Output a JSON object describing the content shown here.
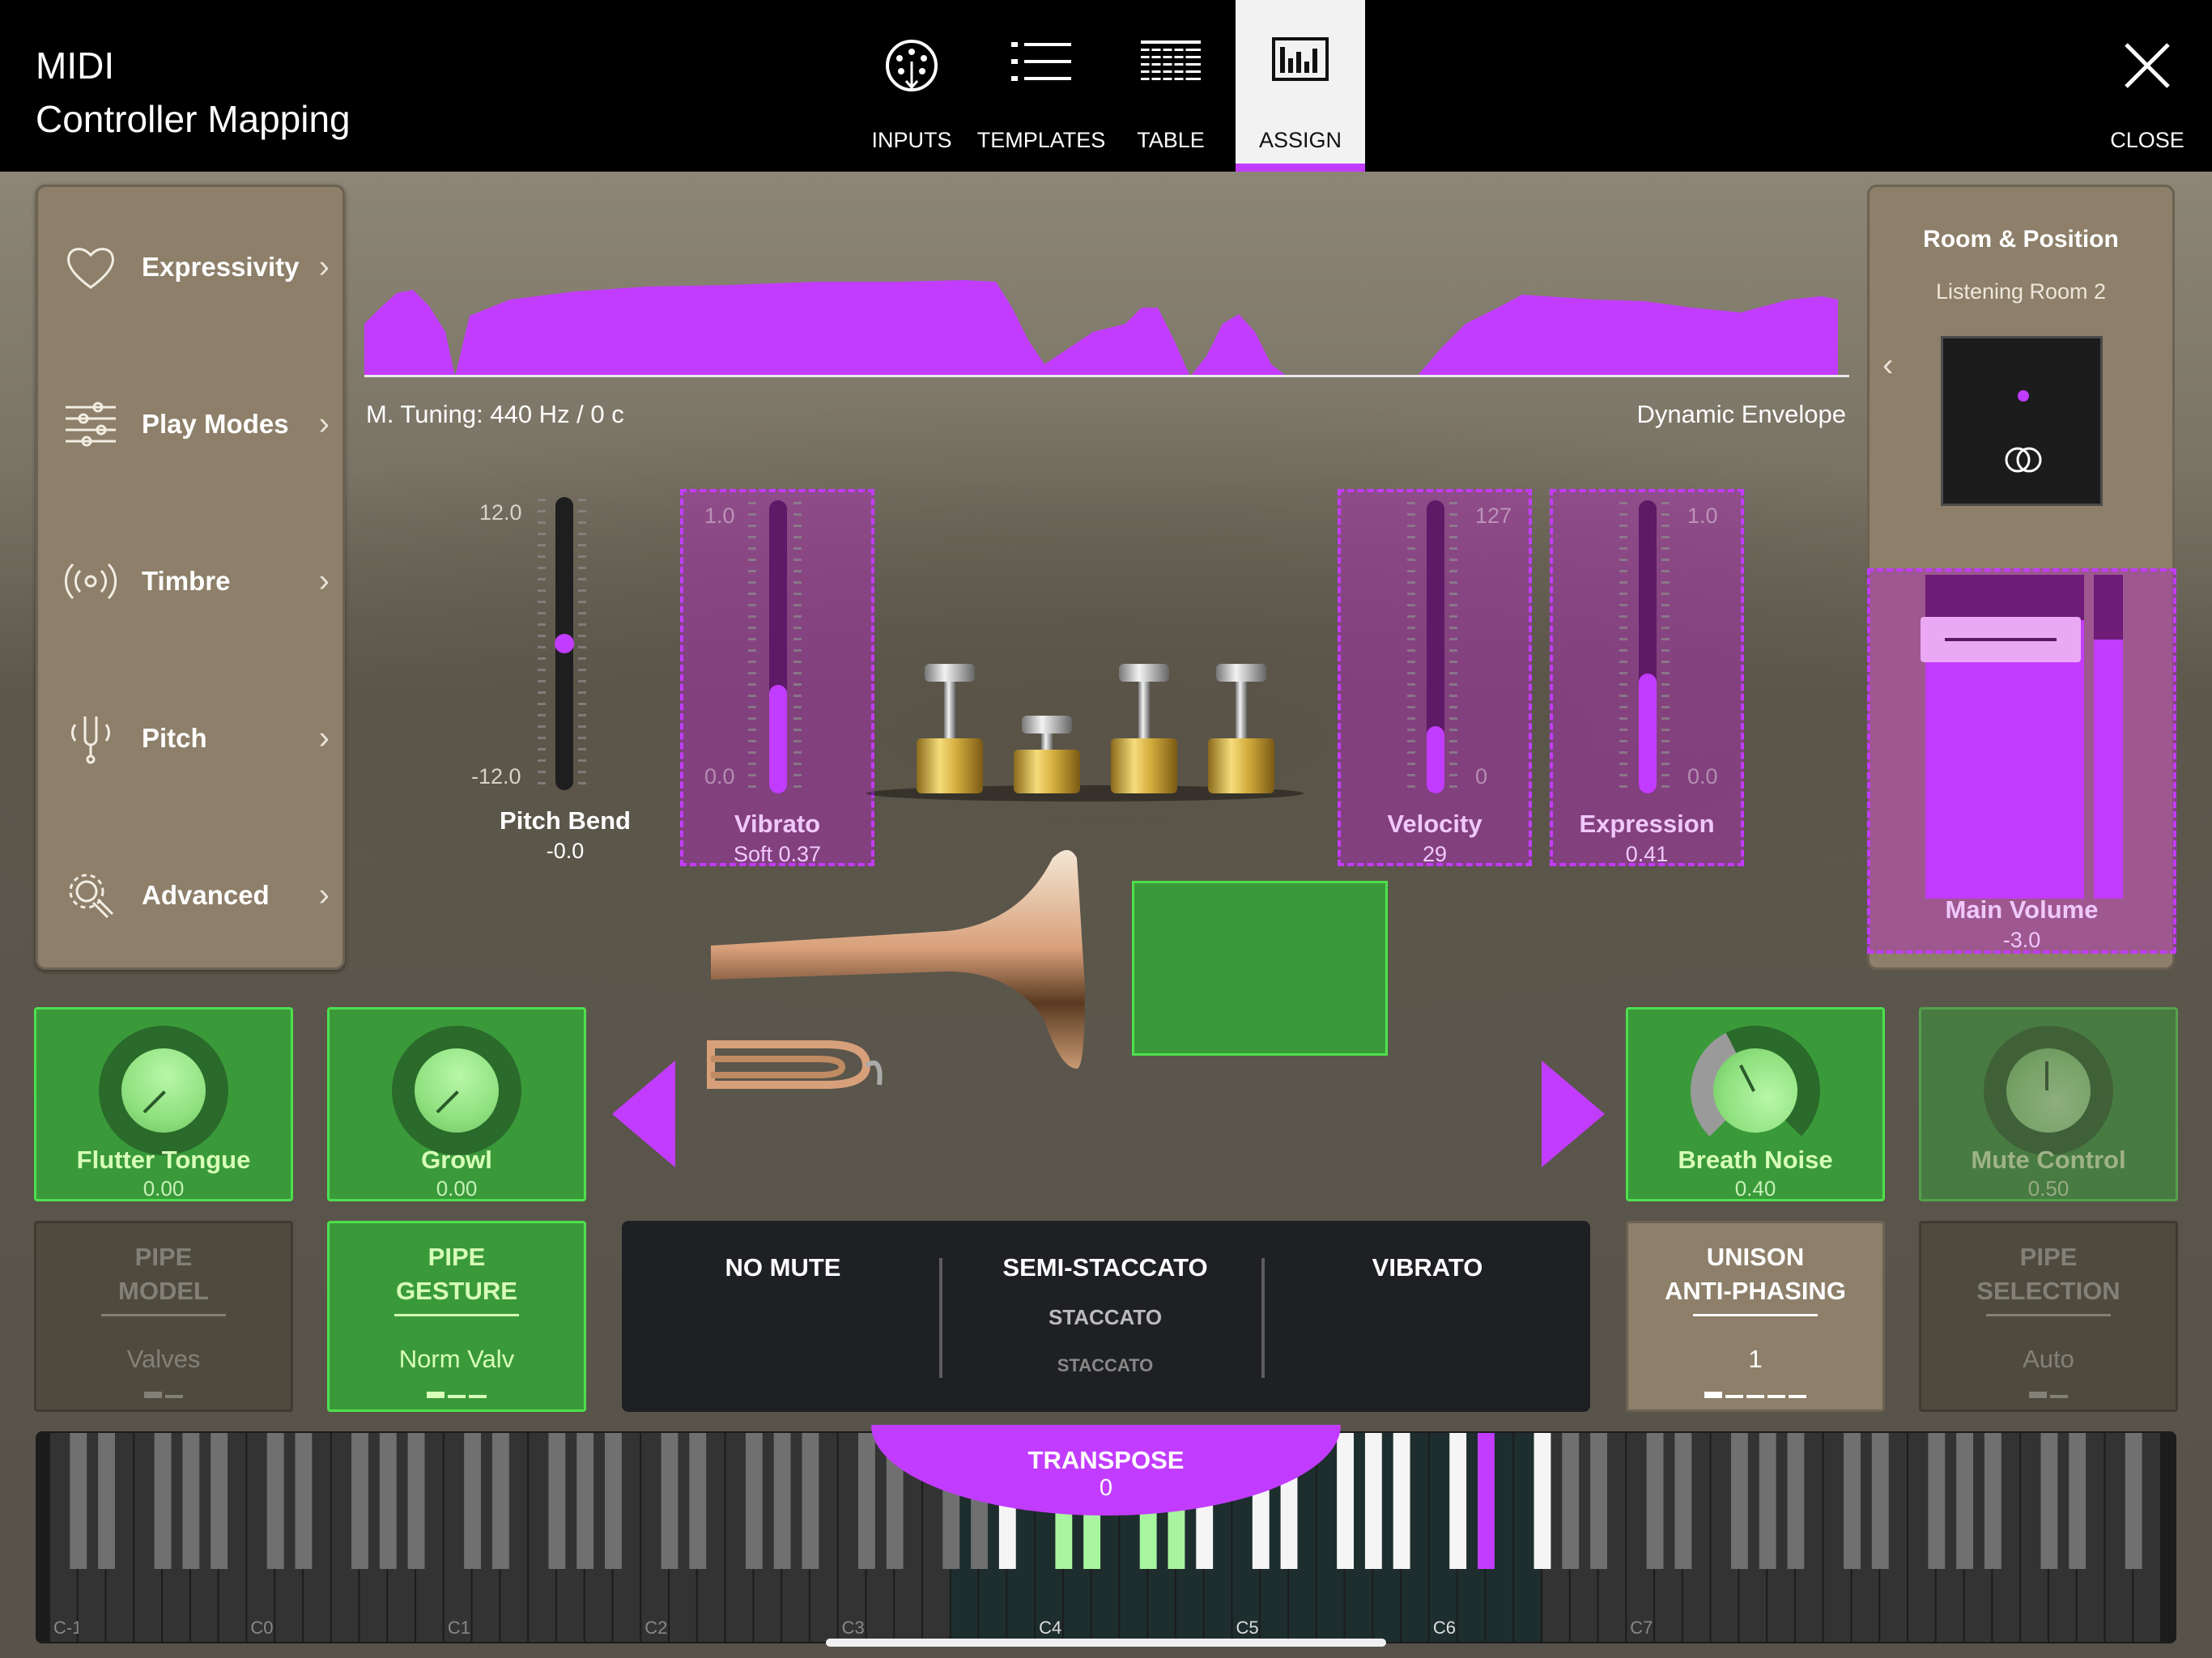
{
  "header": {
    "title_line1": "MIDI",
    "title_line2": "Controller Mapping",
    "tabs": [
      {
        "label": "INPUTS",
        "icon": "midi-port-icon"
      },
      {
        "label": "TEMPLATES",
        "icon": "list-icon"
      },
      {
        "label": "TABLE",
        "icon": "table-icon"
      },
      {
        "label": "ASSIGN",
        "icon": "assign-icon",
        "active": true
      }
    ],
    "close_label": "CLOSE"
  },
  "sidebar": {
    "items": [
      {
        "label": "Expressivity",
        "icon": "heart-icon"
      },
      {
        "label": "Play Modes",
        "icon": "sliders-icon"
      },
      {
        "label": "Timbre",
        "icon": "radiate-icon"
      },
      {
        "label": "Pitch",
        "icon": "tuning-fork-icon"
      },
      {
        "label": "Advanced",
        "icon": "gear-hand-icon"
      }
    ]
  },
  "envelope": {
    "tuning_label": "M. Tuning: 440 Hz / 0 c",
    "dynamic_label": "Dynamic Envelope"
  },
  "sliders": [
    {
      "name": "Pitch Bend",
      "value": "-0.0",
      "max": "12.0",
      "min": "-12.0",
      "fraction": 0.5,
      "assigned": false,
      "style": "dot"
    },
    {
      "name": "Vibrato",
      "value": "Soft  0.37",
      "max": "1.0",
      "min": "0.0",
      "fraction": 0.37,
      "assigned": true
    },
    {
      "name": "Velocity",
      "value": "29",
      "max": "127",
      "min": "0",
      "fraction": 0.23,
      "assigned": true
    },
    {
      "name": "Expression",
      "value": "0.41",
      "max": "1.0",
      "min": "0.0",
      "fraction": 0.41,
      "assigned": true
    }
  ],
  "room": {
    "title": "Room & Position",
    "subtitle": "Listening Room 2"
  },
  "main_volume": {
    "name": "Main Volume",
    "value": "-3.0"
  },
  "knobs": [
    {
      "name": "Flutter Tongue",
      "value": "0.00"
    },
    {
      "name": "Growl",
      "value": "0.00"
    },
    {
      "name": "Breath Noise",
      "value": "0.40"
    },
    {
      "name": "Mute Control",
      "value": "0.50"
    }
  ],
  "pipes": [
    {
      "line1": "PIPE",
      "line2": "MODEL",
      "value": "Valves",
      "state": "dim"
    },
    {
      "line1": "PIPE",
      "line2": "GESTURE",
      "value": "Norm Valv",
      "state": "green"
    },
    {
      "line1": "UNISON",
      "line2": "ANTI-PHASING",
      "value": "1",
      "state": "tan"
    },
    {
      "line1": "PIPE",
      "line2": "SELECTION",
      "value": "Auto",
      "state": "dim"
    }
  ],
  "articulations": [
    {
      "main": "NO MUTE",
      "sub": "",
      "sub2": ""
    },
    {
      "main": "SEMI-STACCATO",
      "sub": "STACCATO",
      "sub2": "STACCATO"
    },
    {
      "main": "VIBRATO",
      "sub": "",
      "sub2": ""
    }
  ],
  "keyboard": {
    "transpose_label": "TRANSPOSE",
    "transpose_value": "0",
    "octave_labels": [
      "C-1",
      "C0",
      "C1",
      "C2",
      "C3",
      "C4",
      "C5",
      "C6",
      "C7"
    ]
  },
  "colors": {
    "accent": "#c23cff",
    "green": "#3a9a3a",
    "green_border": "#4de04d",
    "panel": "#8d7f69"
  }
}
